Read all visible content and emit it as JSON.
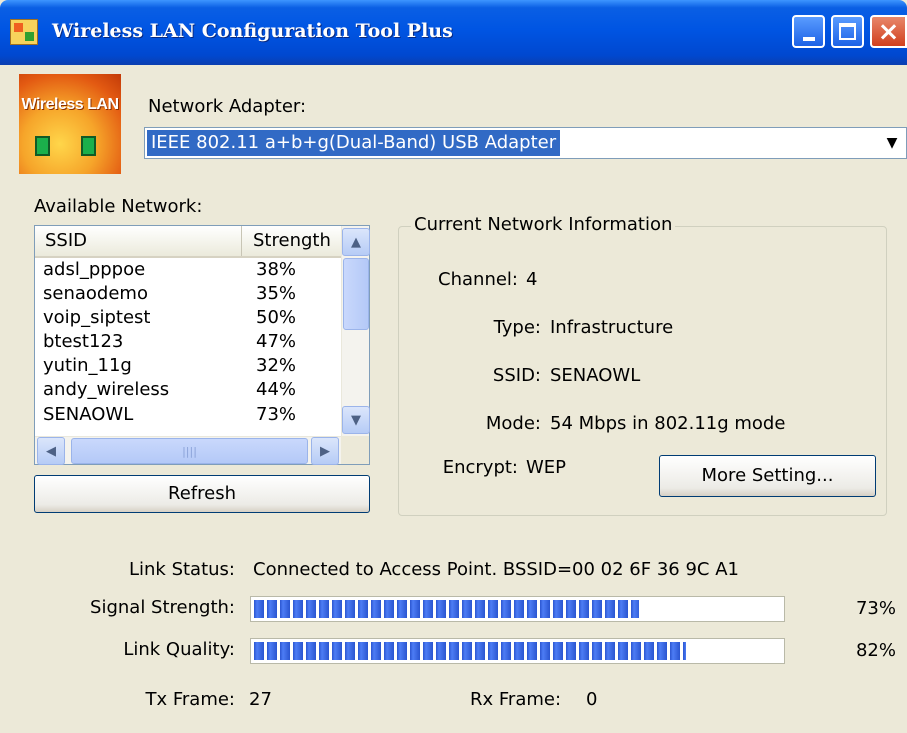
{
  "window": {
    "title": "Wireless LAN Configuration Tool Plus",
    "logo_text": "Wireless LAN"
  },
  "adapter": {
    "label": "Network Adapter:",
    "selected": "IEEE 802.11 a+b+g(Dual-Band) USB Adapter"
  },
  "available": {
    "label": "Available Network:",
    "columns": [
      "SSID",
      "Strength"
    ],
    "rows": [
      {
        "ssid": "adsl_pppoe",
        "strength": "38%"
      },
      {
        "ssid": "senaodemo",
        "strength": "35%"
      },
      {
        "ssid": "voip_siptest",
        "strength": "50%"
      },
      {
        "ssid": "btest123",
        "strength": "47%"
      },
      {
        "ssid": "yutin_11g",
        "strength": "32%"
      },
      {
        "ssid": "andy_wireless",
        "strength": "44%"
      },
      {
        "ssid": "SENAOWL",
        "strength": "73%"
      }
    ],
    "refresh_label": "Refresh"
  },
  "current": {
    "title": "Current Network Information",
    "channel_label": "Channel:",
    "channel": "4",
    "type_label": "Type:",
    "type": "Infrastructure",
    "ssid_label": "SSID:",
    "ssid": "SENAOWL",
    "mode_label": "Mode:",
    "mode": "54 Mbps in 802.11g mode",
    "encrypt_label": "Encrypt:",
    "encrypt": "WEP",
    "more_label": "More Setting..."
  },
  "status": {
    "link_label": "Link Status:",
    "link_value": "Connected to Access Point. BSSID=00 02 6F 36 9C A1",
    "signal_label": "Signal Strength:",
    "signal_pct": "73%",
    "signal_level": 0.73,
    "quality_label": "Link Quality:",
    "quality_pct": "82%",
    "quality_level": 0.82,
    "tx_label": "Tx Frame:",
    "tx_value": "27",
    "rx_label": "Rx Frame:",
    "rx_value": "0"
  },
  "icons": [
    "app-icon",
    "minimize-icon",
    "maximize-icon",
    "close-icon",
    "wireless-lan-logo",
    "dropdown-arrow-icon",
    "scroll-up-icon",
    "scroll-down-icon",
    "scroll-left-icon",
    "scroll-right-icon"
  ]
}
